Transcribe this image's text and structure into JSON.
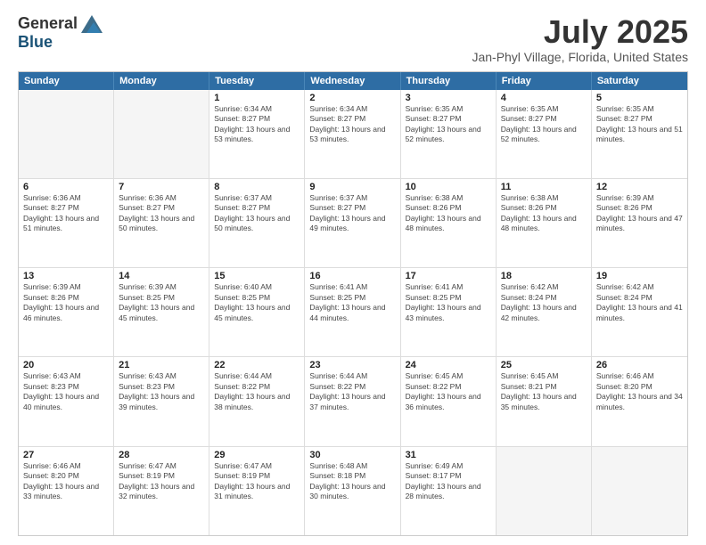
{
  "header": {
    "logo_general": "General",
    "logo_blue": "Blue",
    "month_title": "July 2025",
    "location": "Jan-Phyl Village, Florida, United States"
  },
  "weekdays": [
    "Sunday",
    "Monday",
    "Tuesday",
    "Wednesday",
    "Thursday",
    "Friday",
    "Saturday"
  ],
  "weeks": [
    [
      {
        "day": "",
        "empty": true
      },
      {
        "day": "",
        "empty": true
      },
      {
        "day": "1",
        "sunrise": "6:34 AM",
        "sunset": "8:27 PM",
        "daylight": "13 hours and 53 minutes."
      },
      {
        "day": "2",
        "sunrise": "6:34 AM",
        "sunset": "8:27 PM",
        "daylight": "13 hours and 53 minutes."
      },
      {
        "day": "3",
        "sunrise": "6:35 AM",
        "sunset": "8:27 PM",
        "daylight": "13 hours and 52 minutes."
      },
      {
        "day": "4",
        "sunrise": "6:35 AM",
        "sunset": "8:27 PM",
        "daylight": "13 hours and 52 minutes."
      },
      {
        "day": "5",
        "sunrise": "6:35 AM",
        "sunset": "8:27 PM",
        "daylight": "13 hours and 51 minutes."
      }
    ],
    [
      {
        "day": "6",
        "sunrise": "6:36 AM",
        "sunset": "8:27 PM",
        "daylight": "13 hours and 51 minutes."
      },
      {
        "day": "7",
        "sunrise": "6:36 AM",
        "sunset": "8:27 PM",
        "daylight": "13 hours and 50 minutes."
      },
      {
        "day": "8",
        "sunrise": "6:37 AM",
        "sunset": "8:27 PM",
        "daylight": "13 hours and 50 minutes."
      },
      {
        "day": "9",
        "sunrise": "6:37 AM",
        "sunset": "8:27 PM",
        "daylight": "13 hours and 49 minutes."
      },
      {
        "day": "10",
        "sunrise": "6:38 AM",
        "sunset": "8:26 PM",
        "daylight": "13 hours and 48 minutes."
      },
      {
        "day": "11",
        "sunrise": "6:38 AM",
        "sunset": "8:26 PM",
        "daylight": "13 hours and 48 minutes."
      },
      {
        "day": "12",
        "sunrise": "6:39 AM",
        "sunset": "8:26 PM",
        "daylight": "13 hours and 47 minutes."
      }
    ],
    [
      {
        "day": "13",
        "sunrise": "6:39 AM",
        "sunset": "8:26 PM",
        "daylight": "13 hours and 46 minutes."
      },
      {
        "day": "14",
        "sunrise": "6:39 AM",
        "sunset": "8:25 PM",
        "daylight": "13 hours and 45 minutes."
      },
      {
        "day": "15",
        "sunrise": "6:40 AM",
        "sunset": "8:25 PM",
        "daylight": "13 hours and 45 minutes."
      },
      {
        "day": "16",
        "sunrise": "6:41 AM",
        "sunset": "8:25 PM",
        "daylight": "13 hours and 44 minutes."
      },
      {
        "day": "17",
        "sunrise": "6:41 AM",
        "sunset": "8:25 PM",
        "daylight": "13 hours and 43 minutes."
      },
      {
        "day": "18",
        "sunrise": "6:42 AM",
        "sunset": "8:24 PM",
        "daylight": "13 hours and 42 minutes."
      },
      {
        "day": "19",
        "sunrise": "6:42 AM",
        "sunset": "8:24 PM",
        "daylight": "13 hours and 41 minutes."
      }
    ],
    [
      {
        "day": "20",
        "sunrise": "6:43 AM",
        "sunset": "8:23 PM",
        "daylight": "13 hours and 40 minutes."
      },
      {
        "day": "21",
        "sunrise": "6:43 AM",
        "sunset": "8:23 PM",
        "daylight": "13 hours and 39 minutes."
      },
      {
        "day": "22",
        "sunrise": "6:44 AM",
        "sunset": "8:22 PM",
        "daylight": "13 hours and 38 minutes."
      },
      {
        "day": "23",
        "sunrise": "6:44 AM",
        "sunset": "8:22 PM",
        "daylight": "13 hours and 37 minutes."
      },
      {
        "day": "24",
        "sunrise": "6:45 AM",
        "sunset": "8:22 PM",
        "daylight": "13 hours and 36 minutes."
      },
      {
        "day": "25",
        "sunrise": "6:45 AM",
        "sunset": "8:21 PM",
        "daylight": "13 hours and 35 minutes."
      },
      {
        "day": "26",
        "sunrise": "6:46 AM",
        "sunset": "8:20 PM",
        "daylight": "13 hours and 34 minutes."
      }
    ],
    [
      {
        "day": "27",
        "sunrise": "6:46 AM",
        "sunset": "8:20 PM",
        "daylight": "13 hours and 33 minutes."
      },
      {
        "day": "28",
        "sunrise": "6:47 AM",
        "sunset": "8:19 PM",
        "daylight": "13 hours and 32 minutes."
      },
      {
        "day": "29",
        "sunrise": "6:47 AM",
        "sunset": "8:19 PM",
        "daylight": "13 hours and 31 minutes."
      },
      {
        "day": "30",
        "sunrise": "6:48 AM",
        "sunset": "8:18 PM",
        "daylight": "13 hours and 30 minutes."
      },
      {
        "day": "31",
        "sunrise": "6:49 AM",
        "sunset": "8:17 PM",
        "daylight": "13 hours and 28 minutes."
      },
      {
        "day": "",
        "empty": true
      },
      {
        "day": "",
        "empty": true
      }
    ]
  ]
}
